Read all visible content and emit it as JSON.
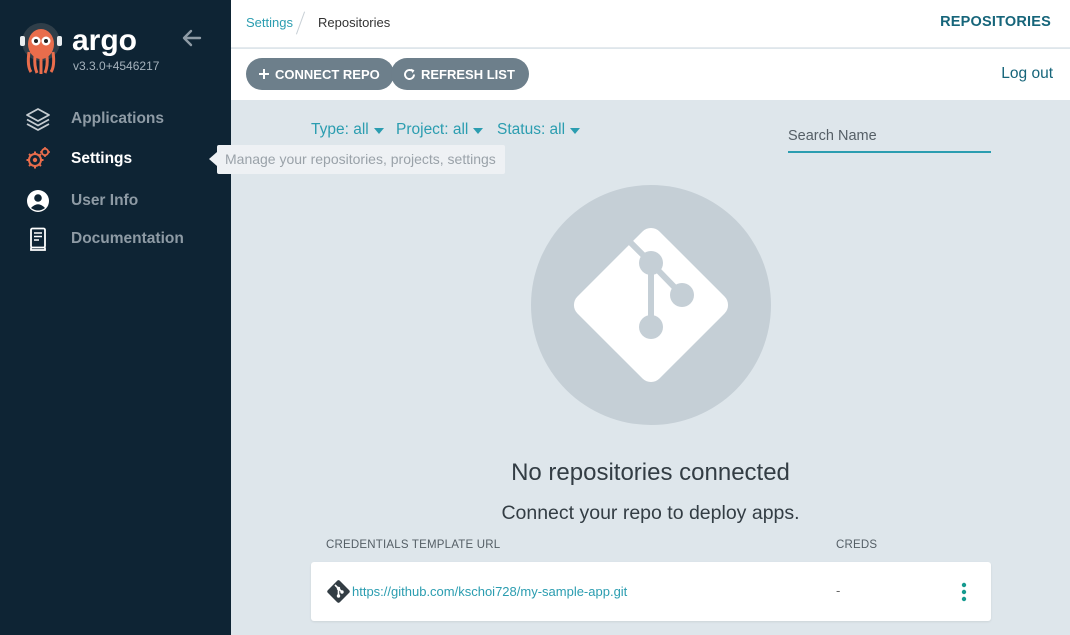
{
  "sidebar": {
    "brand": "argo",
    "version": "v3.3.0+4546217",
    "items": [
      {
        "label": "Applications",
        "icon": "layers-icon"
      },
      {
        "label": "Settings",
        "icon": "gears-icon"
      },
      {
        "label": "User Info",
        "icon": "user-circle-icon"
      },
      {
        "label": "Documentation",
        "icon": "book-icon"
      }
    ],
    "active": "Settings",
    "tooltip": "Manage your repositories, projects, settings"
  },
  "breadcrumb": {
    "items": [
      "Settings",
      "Repositories"
    ]
  },
  "header": {
    "page_label": "REPOSITORIES"
  },
  "toolbar": {
    "connect_label": "CONNECT REPO",
    "refresh_label": "REFRESH LIST",
    "logout_label": "Log out"
  },
  "filters": {
    "type": "Type: all",
    "project": "Project: all",
    "status": "Status: all",
    "search_placeholder": "Search Name"
  },
  "empty_state": {
    "title": "No repositories connected",
    "subtitle": "Connect your repo to deploy apps."
  },
  "credentials_table": {
    "columns": [
      "CREDENTIALS TEMPLATE URL",
      "CREDS"
    ],
    "rows": [
      {
        "url": "https://github.com/kschoi728/my-sample-app.git",
        "creds": "-"
      }
    ]
  },
  "colors": {
    "sidebar_bg": "#0e2434",
    "accent": "#2b9db0",
    "button_bg": "#6d7f8b",
    "content_bg": "#dee6eb",
    "logo_orange": "#e96d4c"
  }
}
